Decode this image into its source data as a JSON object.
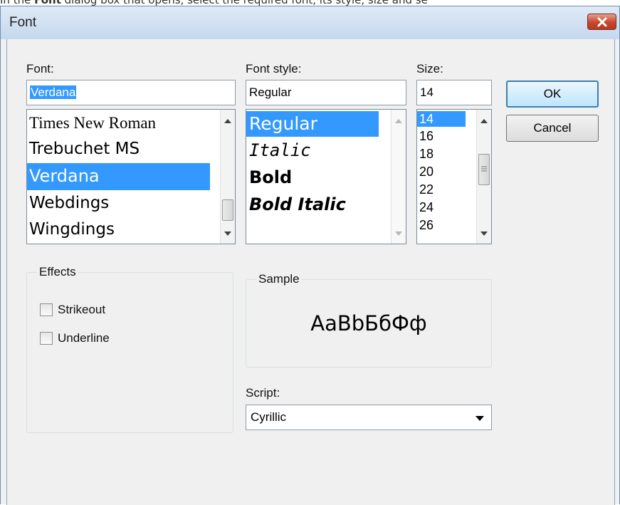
{
  "caption": {
    "before": "In the ",
    "bold": "Font",
    "after": " dialog box that opens, select the required font, its style, size and se"
  },
  "dialog": {
    "title": "Font",
    "font_label": "Font:",
    "font_value": "Verdana",
    "font_list": [
      "Times New Roman",
      "Trebuchet MS",
      "Verdana",
      "Webdings",
      "Wingdings"
    ],
    "font_selected": "Verdana",
    "style_label": "Font style:",
    "style_value": "Regular",
    "style_list": [
      "Regular",
      "Italic",
      "Bold",
      "Bold Italic"
    ],
    "style_selected": "Regular",
    "size_label": "Size:",
    "size_value": "14",
    "size_list": [
      "14",
      "16",
      "18",
      "20",
      "22",
      "24",
      "26"
    ],
    "size_selected": "14",
    "ok_label": "OK",
    "cancel_label": "Cancel",
    "effects_title": "Effects",
    "strikeout_label": "Strikeout",
    "strikeout_checked": false,
    "underline_label": "Underline",
    "underline_checked": false,
    "sample_title": "Sample",
    "sample_text": "AaBbБбФф",
    "script_label": "Script:",
    "script_value": "Cyrillic"
  },
  "colors": {
    "selection": "#3399ff",
    "close_button": "#c7462c",
    "dialog_bg": "#f0f0f0"
  },
  "icons": {
    "close": "close-x-icon",
    "scroll_up": "scroll-up-arrow-icon",
    "scroll_down": "scroll-down-arrow-icon",
    "dropdown": "chevron-down-icon"
  }
}
